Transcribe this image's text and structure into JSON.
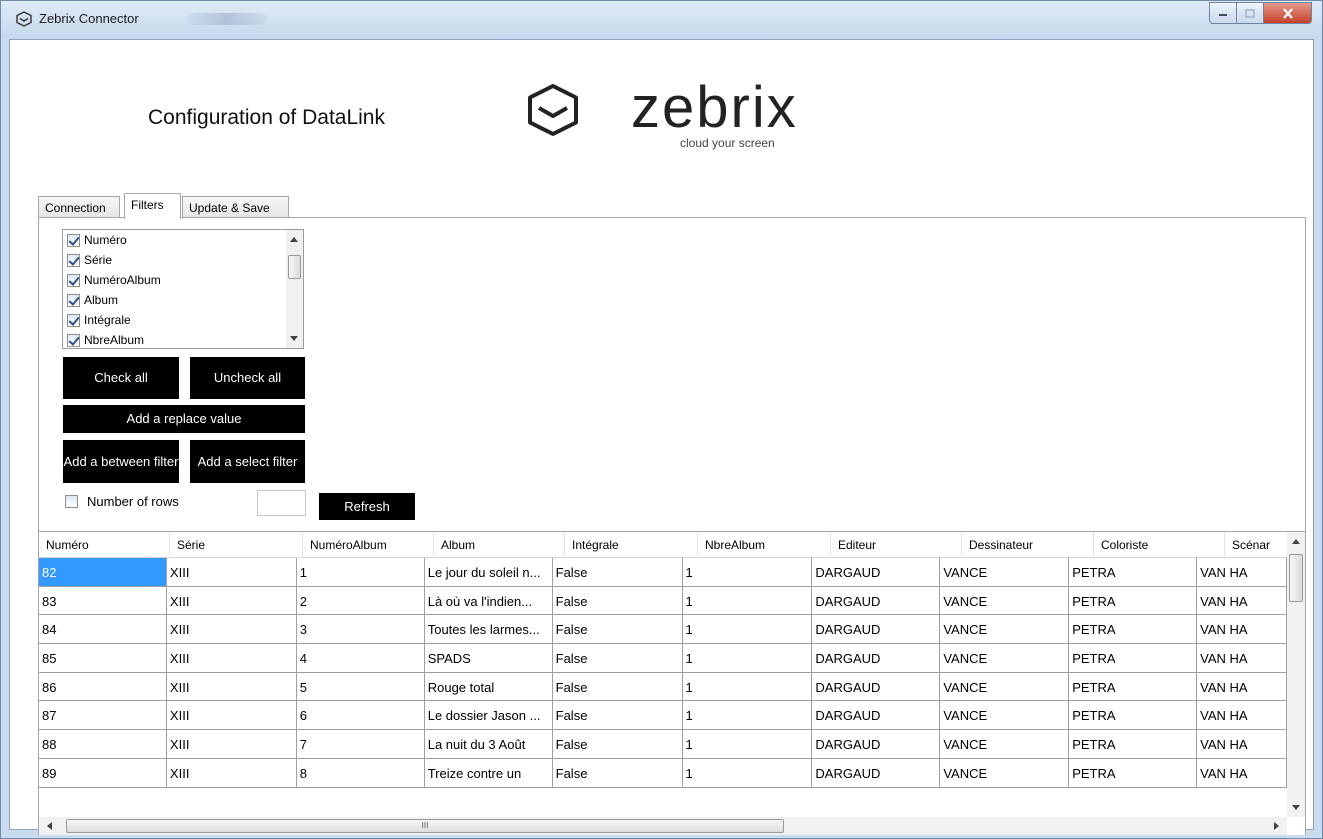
{
  "window": {
    "title": "Zebrix Connector",
    "accent_close": "#c6402a"
  },
  "header": {
    "title": "Configuration of DataLink",
    "logo_word": "zebrix",
    "logo_tagline": "cloud your screen"
  },
  "tabs": [
    {
      "label": "Connection",
      "active": false
    },
    {
      "label": "Filters",
      "active": true
    },
    {
      "label": "Update & Save",
      "active": false
    }
  ],
  "filters": {
    "columns": [
      {
        "label": "Numéro",
        "checked": true
      },
      {
        "label": "Série",
        "checked": true
      },
      {
        "label": "NuméroAlbum",
        "checked": true
      },
      {
        "label": "Album",
        "checked": true
      },
      {
        "label": "Intégrale",
        "checked": true
      },
      {
        "label": "NbreAlbum",
        "checked": true
      }
    ],
    "check_all_label": "Check all",
    "uncheck_all_label": "Uncheck all",
    "replace_value_label": "Add a replace value",
    "between_filter_label": "Add a between filter",
    "select_filter_label": "Add a select filter",
    "number_of_rows_label": "Number of rows",
    "number_of_rows_checked": false,
    "number_of_rows_value": "",
    "refresh_label": "Refresh"
  },
  "grid": {
    "columns": [
      "Numéro",
      "Série",
      "NuméroAlbum",
      "Album",
      "Intégrale",
      "NbreAlbum",
      "Editeur",
      "Dessinateur",
      "Coloriste",
      "Scénar"
    ],
    "rows": [
      [
        "82",
        "XIII",
        "1",
        "Le jour du soleil n...",
        "False",
        "1",
        "DARGAUD",
        "VANCE",
        "PETRA",
        "VAN HA"
      ],
      [
        "83",
        "XIII",
        "2",
        "Là où va l'indien...",
        "False",
        "1",
        "DARGAUD",
        "VANCE",
        "PETRA",
        "VAN HA"
      ],
      [
        "84",
        "XIII",
        "3",
        "Toutes les larmes...",
        "False",
        "1",
        "DARGAUD",
        "VANCE",
        "PETRA",
        "VAN HA"
      ],
      [
        "85",
        "XIII",
        "4",
        "SPADS",
        "False",
        "1",
        "DARGAUD",
        "VANCE",
        "PETRA",
        "VAN HA"
      ],
      [
        "86",
        "XIII",
        "5",
        "Rouge total",
        "False",
        "1",
        "DARGAUD",
        "VANCE",
        "PETRA",
        "VAN HA"
      ],
      [
        "87",
        "XIII",
        "6",
        "Le dossier Jason ...",
        "False",
        "1",
        "DARGAUD",
        "VANCE",
        "PETRA",
        "VAN HA"
      ],
      [
        "88",
        "XIII",
        "7",
        "La nuit du 3 Août",
        "False",
        "1",
        "DARGAUD",
        "VANCE",
        "PETRA",
        "VAN HA"
      ],
      [
        "89",
        "XIII",
        "8",
        "Treize contre un",
        "False",
        "1",
        "DARGAUD",
        "VANCE",
        "PETRA",
        "VAN HA"
      ]
    ],
    "selected_cell": [
      0,
      0
    ],
    "hscroll_grip": "III"
  }
}
